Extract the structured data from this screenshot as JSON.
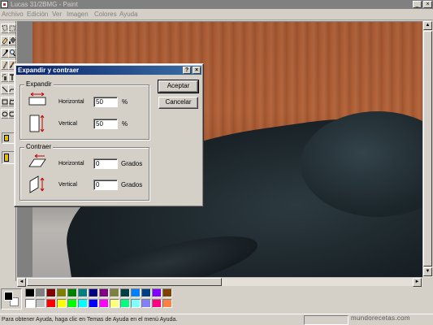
{
  "app": {
    "title": "Lucas 31/2BMG - Paint",
    "minimize": "_",
    "close": "×"
  },
  "menu": [
    "Archivo",
    "Edición",
    "Ver",
    "Imagen",
    "Colores",
    "Ayuda"
  ],
  "toolbox": {
    "tools": [
      "free-select",
      "rect-select",
      "eraser",
      "fill",
      "color-picker",
      "magnifier",
      "pencil",
      "brush",
      "airbrush",
      "text",
      "line",
      "curve",
      "rectangle",
      "polygon",
      "ellipse",
      "rounded-rect"
    ]
  },
  "dialog": {
    "title": "Expandir y contraer",
    "help": "?",
    "close": "×",
    "stretch": {
      "label": "Expandir",
      "horizontal_label": "Horizontal",
      "horizontal_value": "50",
      "horizontal_unit": "%",
      "vertical_label": "Vertical",
      "vertical_value": "50",
      "vertical_unit": "%"
    },
    "skew": {
      "label": "Contraer",
      "horizontal_label": "Horizontal",
      "horizontal_value": "0",
      "horizontal_unit": "Grados",
      "vertical_label": "Vertical",
      "vertical_value": "0",
      "vertical_unit": "Grados"
    },
    "accept_label": "Aceptar",
    "cancel_label": "Cancelar"
  },
  "palette": {
    "colors": [
      "#000000",
      "#808080",
      "#800000",
      "#808000",
      "#008000",
      "#008080",
      "#000080",
      "#800080",
      "#808040",
      "#004040",
      "#0080ff",
      "#004080",
      "#8000ff",
      "#804000",
      "#ffffff",
      "#c0c0c0",
      "#ff0000",
      "#ffff00",
      "#00ff00",
      "#00ffff",
      "#0000ff",
      "#ff00ff",
      "#ffff80",
      "#00ff80",
      "#80ffff",
      "#8080ff",
      "#ff0080",
      "#ff8040"
    ]
  },
  "status": {
    "text": "Para obtener Ayuda, haga clic en Temas de Ayuda en el menú Ayuda."
  },
  "watermark": "mundorecetas.com"
}
